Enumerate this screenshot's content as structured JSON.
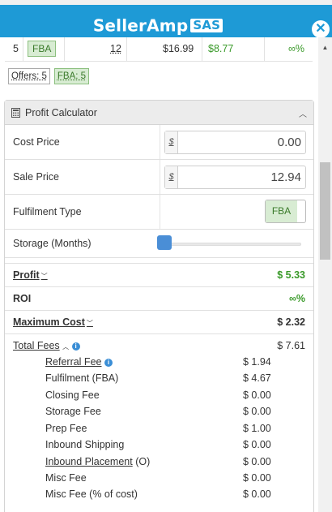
{
  "header": {
    "brand": "SellerAmp",
    "badge": "SAS",
    "close": "✕"
  },
  "offers_row": {
    "rank": "5",
    "fulfilment": "FBA",
    "qty": "12",
    "price": "$16.99",
    "profit": "$8.77",
    "roi": "∞%"
  },
  "offer_tags": {
    "offers": "Offers: 5",
    "fba": "FBA: 5"
  },
  "panel": {
    "title": "Profit Calculator"
  },
  "fields": {
    "cost_price": {
      "label": "Cost Price",
      "currency": "$",
      "value": "0.00"
    },
    "sale_price": {
      "label": "Sale Price",
      "currency": "$",
      "value": "12.94"
    },
    "fulfilment_type": {
      "label": "Fulfilment Type",
      "value": "FBA"
    },
    "storage": {
      "label": "Storage (Months)",
      "level": 0
    }
  },
  "summary": {
    "profit": {
      "label": "Profit",
      "value": "$ 5.33"
    },
    "roi": {
      "label": "ROI",
      "value": "∞%"
    },
    "max_cost": {
      "label": "Maximum Cost",
      "value": "$ 2.32"
    }
  },
  "fees": {
    "label": "Total Fees",
    "total": "$ 7.61",
    "items": [
      {
        "label": "Referral Fee",
        "value": "$ 1.94"
      },
      {
        "label": "Fulfilment (FBA)",
        "value": "$ 4.67"
      },
      {
        "label": "Closing Fee",
        "value": "$ 0.00"
      },
      {
        "label": "Storage Fee",
        "value": "$ 0.00"
      },
      {
        "label": "Prep Fee",
        "value": "$ 1.00"
      },
      {
        "label": "Inbound Shipping",
        "value": "$ 0.00"
      },
      {
        "label": "Inbound Placement",
        "suffix": "(O)",
        "value": "$ 0.00"
      },
      {
        "label": "Misc Fee",
        "value": "$ 0.00"
      },
      {
        "label": "Misc Fee (% of cost)",
        "value": "$ 0.00"
      }
    ]
  },
  "colors": {
    "brand_blue": "#1e9ad6",
    "profit_green": "#3a9a2a",
    "fba_green_bg": "#d8ecd3",
    "slider_blue": "#4a8ed6"
  }
}
